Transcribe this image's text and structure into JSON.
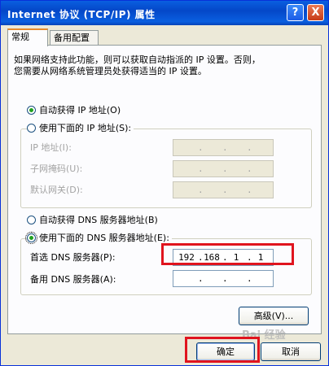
{
  "window": {
    "title": "Internet 协议 (TCP/IP) 属性"
  },
  "titlebar_buttons": {
    "help": "?",
    "close": "X"
  },
  "tabs": [
    {
      "label": "常规"
    },
    {
      "label": "备用配置"
    }
  ],
  "description": {
    "line1": "如果网络支持此功能，则可以获取自动指派的 IP 设置。否则，",
    "line2": "您需要从网络系统管理员处获得适当的 IP 设置。"
  },
  "ip_options": {
    "auto": "自动获得 IP 地址(O)",
    "manual": "使用下面的 IP 地址(S):",
    "selected": "auto"
  },
  "ip_fields": [
    {
      "label": "IP 地址(I):",
      "value": "   .   .   ."
    },
    {
      "label": "子网掩码(U):",
      "value": "   .   .   ."
    },
    {
      "label": "默认网关(D):",
      "value": "   .   .   ."
    }
  ],
  "dns_options": {
    "auto": "自动获得 DNS 服务器地址(B)",
    "manual": "使用下面的 DNS 服务器地址(E):",
    "selected": "manual"
  },
  "dns_fields": [
    {
      "label": "首选 DNS 服务器(P):",
      "segments": [
        "192",
        "168",
        "1",
        "1"
      ]
    },
    {
      "label": "备用 DNS 服务器(A):",
      "segments": [
        "",
        "",
        "",
        ""
      ]
    }
  ],
  "buttons": {
    "advanced": "高级(V)...",
    "ok": "确定",
    "cancel": "取消"
  },
  "watermark": "Bai 经验",
  "colors": {
    "title_bar": "#0a5fe0",
    "highlight": "#e0141e",
    "window_bg": "#ece9d8"
  }
}
